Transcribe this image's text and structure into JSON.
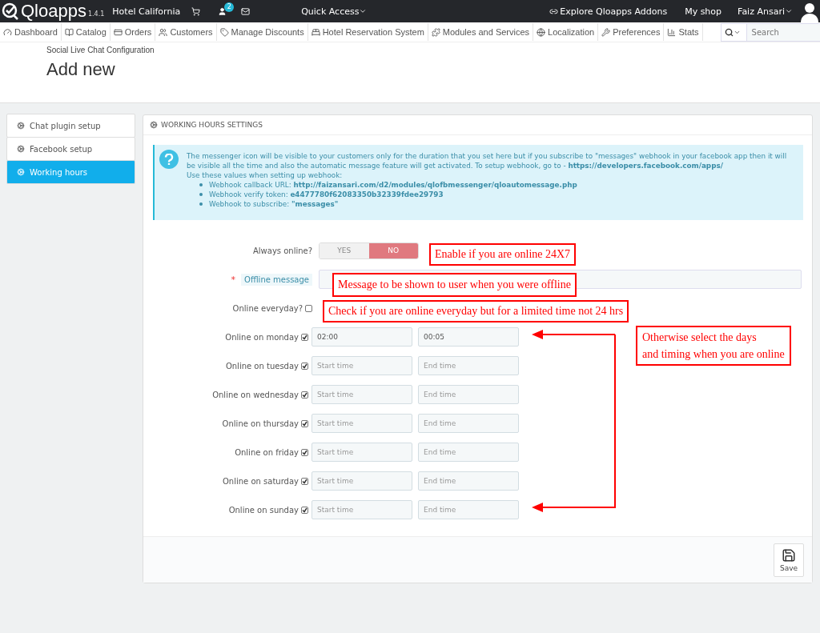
{
  "topbar": {
    "logo": "Qloapps",
    "version": "1.4.1",
    "shop_name": "Hotel California",
    "notification_count": "2",
    "quick_access": "Quick Access",
    "addons": "Explore Qloapps Addons",
    "my_shop": "My shop",
    "user": "Faiz Ansari"
  },
  "nav": [
    {
      "label": "Dashboard",
      "kind": "dashboard"
    },
    {
      "label": "Catalog",
      "kind": "book"
    },
    {
      "label": "Orders",
      "kind": "card"
    },
    {
      "label": "Customers",
      "kind": "users"
    },
    {
      "label": "Manage Discounts",
      "kind": "tag"
    },
    {
      "label": "Hotel Reservation System",
      "kind": "bed"
    },
    {
      "label": "Modules and Services",
      "kind": "puzzle"
    },
    {
      "label": "Localization",
      "kind": "globe"
    },
    {
      "label": "Preferences",
      "kind": "wrench"
    },
    {
      "label": "Stats",
      "kind": "chart"
    }
  ],
  "search": {
    "placeholder": "Search"
  },
  "breadcrumb": "Social Live Chat Configuration",
  "page_title": "Add new",
  "sidebar": [
    {
      "label": "Chat plugin setup",
      "selected": false
    },
    {
      "label": "Facebook setup",
      "selected": false
    },
    {
      "label": "Working hours",
      "selected": true
    }
  ],
  "panel": {
    "title": "WORKING HOURS SETTINGS",
    "info": {
      "text": "The messenger icon will be visible to your customers only for the duration that you set here but if you subscribe to \"messages\" webhook in your facebook app then it will be visible all the time and also the automatic message feature will get activated. To setup webhook, go to - **https://developers.facebook.com/apps/**",
      "intro": "Use these values when setting up webhook:",
      "items": [
        "Webhook callback URL: **http://faizansari.com/d2/modules/qlofbmessenger/qloautomessage.php**",
        "Webhook verify token: **e4477780f62083350b32339fdee29793**",
        "Webhook to subscribe: **\"messages\"**"
      ]
    },
    "always_online": {
      "label": "Always online?",
      "options": [
        {
          "label": "YES",
          "selected": false
        },
        {
          "label": "NO",
          "selected": true
        }
      ]
    },
    "offline_message": {
      "label": "Offline message",
      "required_mark": "*"
    },
    "online_everyday": {
      "label": "Online everyday?",
      "checked": false
    },
    "days": [
      {
        "label": "Online on monday",
        "checked": true,
        "start": "02:00",
        "end": "00:05"
      },
      {
        "label": "Online on tuesday",
        "checked": true,
        "start_placeholder": "Start time",
        "end_placeholder": "End time"
      },
      {
        "label": "Online on wednesday",
        "checked": true,
        "start_placeholder": "Start time",
        "end_placeholder": "End time"
      },
      {
        "label": "Online on thursday",
        "checked": true,
        "start_placeholder": "Start time",
        "end_placeholder": "End time"
      },
      {
        "label": "Online on friday",
        "checked": true,
        "start_placeholder": "Start time",
        "end_placeholder": "End time"
      },
      {
        "label": "Online on saturday",
        "checked": true,
        "start_placeholder": "Start time",
        "end_placeholder": "End time"
      },
      {
        "label": "Online on sunday",
        "checked": true,
        "start_placeholder": "Start time",
        "end_placeholder": "End time"
      }
    ],
    "save": "Save"
  },
  "annotations": [
    {
      "text": "Enable if you are online 24X7"
    },
    {
      "text": "Message to be shown to user when you were offline"
    },
    {
      "text": "Check if you are online everyday but for a limited time not 24 hrs"
    },
    {
      "lines": [
        "Otherwise select the days",
        "and timing when you are online"
      ]
    }
  ]
}
